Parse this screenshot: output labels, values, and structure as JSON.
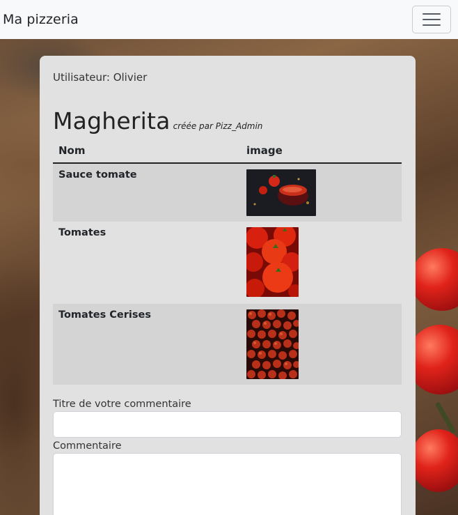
{
  "navbar": {
    "brand": "Ma pizzeria"
  },
  "card": {
    "user_label": "Utilisateur: Olivier",
    "pizza_name": "Magherita",
    "author_text": "créée par Pizz_Admin"
  },
  "table": {
    "headers": [
      "Nom",
      "image"
    ],
    "rows": [
      {
        "name": "Sauce tomate",
        "image_icon": "tomato-sauce-photo"
      },
      {
        "name": "Tomates",
        "image_icon": "tomatoes-photo"
      },
      {
        "name": "Tomates Cerises",
        "image_icon": "cherry-tomatoes-photo"
      }
    ]
  },
  "form": {
    "title_label": "Titre de votre commentaire",
    "title_value": "",
    "comment_label": "Commentaire",
    "comment_value": ""
  },
  "colors": {
    "navbar_bg": "#f8f9fa",
    "card_bg": "#e1e1e1",
    "stripe_bg": "#d4d4d4"
  }
}
